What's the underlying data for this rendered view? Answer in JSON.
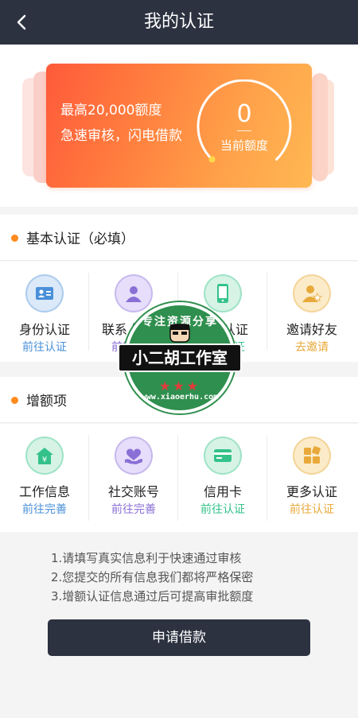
{
  "header": {
    "title": "我的认证",
    "back_icon": "chevron-left-icon"
  },
  "credit_card": {
    "line1": "最高20,000额度",
    "line2": "急速审核，闪电借款",
    "current_amount": "0",
    "current_amount_label": "当前额度",
    "gauge_level": 0
  },
  "basic_section": {
    "title": "基本认证（必填）",
    "items": [
      {
        "name": "身份认证",
        "action": "前往认证",
        "icon": "id-card-icon",
        "color": "#4a90d9",
        "bg": "#dbe9f8"
      },
      {
        "name": "联系人认证",
        "action": "前往认证",
        "icon": "contact-person-icon",
        "color": "#8a6fd6",
        "bg": "#e6defa"
      },
      {
        "name": "手机认证",
        "action": "前往认证",
        "icon": "phone-icon",
        "color": "#34c28a",
        "bg": "#d6f3e6"
      },
      {
        "name": "邀请好友",
        "action": "去邀请",
        "icon": "invite-friend-icon",
        "color": "#e8a93a",
        "bg": "#fbebc9"
      }
    ]
  },
  "extra_section": {
    "title": "增额项",
    "items": [
      {
        "name": "工作信息",
        "action": "前往完善",
        "icon": "work-info-icon",
        "color": "#34c28a",
        "bg": "#d6f3e6",
        "action_color": "#4a90d9"
      },
      {
        "name": "社交账号",
        "action": "前往完善",
        "icon": "social-account-icon",
        "color": "#8a6fd6",
        "bg": "#e6defa",
        "action_color": "#8a6fd6"
      },
      {
        "name": "信用卡",
        "action": "前往认证",
        "icon": "credit-card-icon",
        "color": "#34c28a",
        "bg": "#d6f3e6",
        "action_color": "#34c28a"
      },
      {
        "name": "更多认证",
        "action": "前往认证",
        "icon": "more-auth-icon",
        "color": "#e8a93a",
        "bg": "#fbebc9",
        "action_color": "#e8a93a"
      }
    ]
  },
  "notes": [
    "1.请填写真实信息利于快速通过审核",
    "2.您提交的所有信息我们都将严格保密",
    "3.增额认证信息通过后可提高审批额度"
  ],
  "apply_button": "申请借款",
  "watermark": {
    "top_text": "专注资源分享",
    "banner": "小二胡工作室",
    "url": "www.xiaoerhu.com",
    "stars": "★★★"
  },
  "colors": {
    "header_bg": "#2c3240",
    "accent_dot": "#ff8a1e",
    "card_from": "#ff5a3a",
    "card_to": "#ffb853"
  }
}
